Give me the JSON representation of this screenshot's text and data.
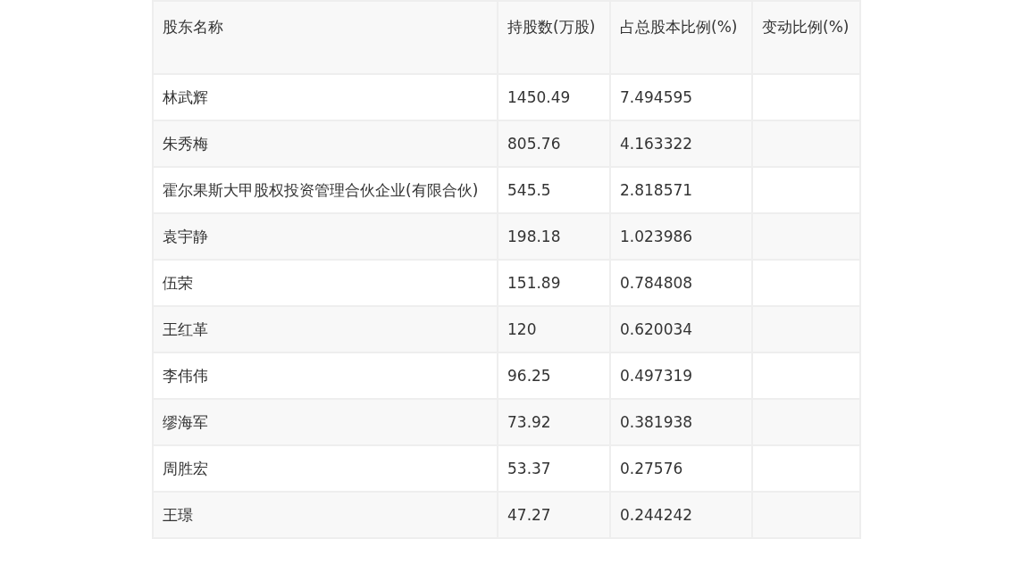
{
  "table": {
    "columns": [
      "股东名称",
      "持股数(万股)",
      "占总股本比例(%)",
      "变动比例(%)"
    ],
    "rows": [
      {
        "cells": [
          "林武辉",
          "1450.49",
          "7.494595",
          ""
        ]
      },
      {
        "cells": [
          "朱秀梅",
          "805.76",
          "4.163322",
          ""
        ]
      },
      {
        "cells": [
          "霍尔果斯大甲股权投资管理合伙企业(有限合伙)",
          "545.5",
          "2.818571",
          ""
        ]
      },
      {
        "cells": [
          "袁宇静",
          "198.18",
          "1.023986",
          ""
        ]
      },
      {
        "cells": [
          "伍荣",
          "151.89",
          "0.784808",
          ""
        ]
      },
      {
        "cells": [
          "王红革",
          "120",
          "0.620034",
          ""
        ]
      },
      {
        "cells": [
          "李伟伟",
          "96.25",
          "0.497319",
          ""
        ]
      },
      {
        "cells": [
          "缪海军",
          "73.92",
          "0.381938",
          ""
        ]
      },
      {
        "cells": [
          "周胜宏",
          "53.37",
          "0.27576",
          ""
        ]
      },
      {
        "cells": [
          "王璟",
          "47.27",
          "0.244242",
          ""
        ]
      }
    ]
  }
}
